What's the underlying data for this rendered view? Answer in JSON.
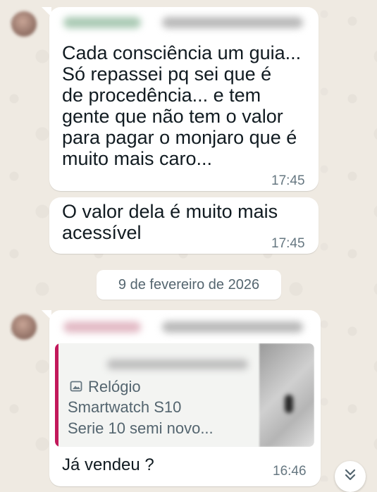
{
  "messages": [
    {
      "text": "Cada consciência um guia...\nSó repassei pq sei que é\nde procedência... e tem\ngente que não tem o valor\npara pagar o monjaro que é\nmuito mais caro...",
      "time": "17:45"
    },
    {
      "text": "O valor dela é muito mais\nacessível",
      "time": "17:45"
    }
  ],
  "date_separator": "9 de fevereiro de 2026",
  "reply_message": {
    "quoted": {
      "title": "Relógio",
      "line2": "Smartwatch S10",
      "line3": "Serie 10 semi novo...",
      "icon": "image-icon"
    },
    "text": "Já vendeu ?",
    "time": "16:46"
  },
  "colors": {
    "chat_background": "#efeae2",
    "bubble": "#ffffff",
    "quote_accent": "#c2185b",
    "time_text": "#667781"
  }
}
